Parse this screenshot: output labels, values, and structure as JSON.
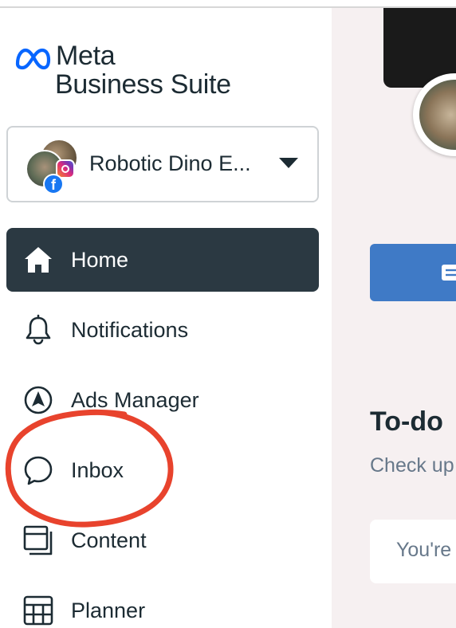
{
  "brand": {
    "logo_line1": "Meta",
    "logo_line2": "Business Suite",
    "accent_color": "#0866ff"
  },
  "account": {
    "name": "Robotic Dino E...",
    "platforms": [
      "instagram",
      "facebook"
    ]
  },
  "sidebar": {
    "items": [
      {
        "label": "Home",
        "icon": "home-icon",
        "active": true
      },
      {
        "label": "Notifications",
        "icon": "bell-icon",
        "active": false
      },
      {
        "label": "Ads Manager",
        "icon": "ads-manager-icon",
        "active": false
      },
      {
        "label": "Inbox",
        "icon": "chat-bubble-icon",
        "active": false
      },
      {
        "label": "Content",
        "icon": "content-icon",
        "active": false
      },
      {
        "label": "Planner",
        "icon": "calendar-grid-icon",
        "active": false
      }
    ],
    "active_color": "#2b3942"
  },
  "annotation": {
    "target": "Inbox",
    "color": "#e8432d"
  },
  "main": {
    "todo_title": "To-do",
    "todo_subtitle": "Check up",
    "status_card_text": "You're",
    "button_color": "#3f7ac6"
  }
}
